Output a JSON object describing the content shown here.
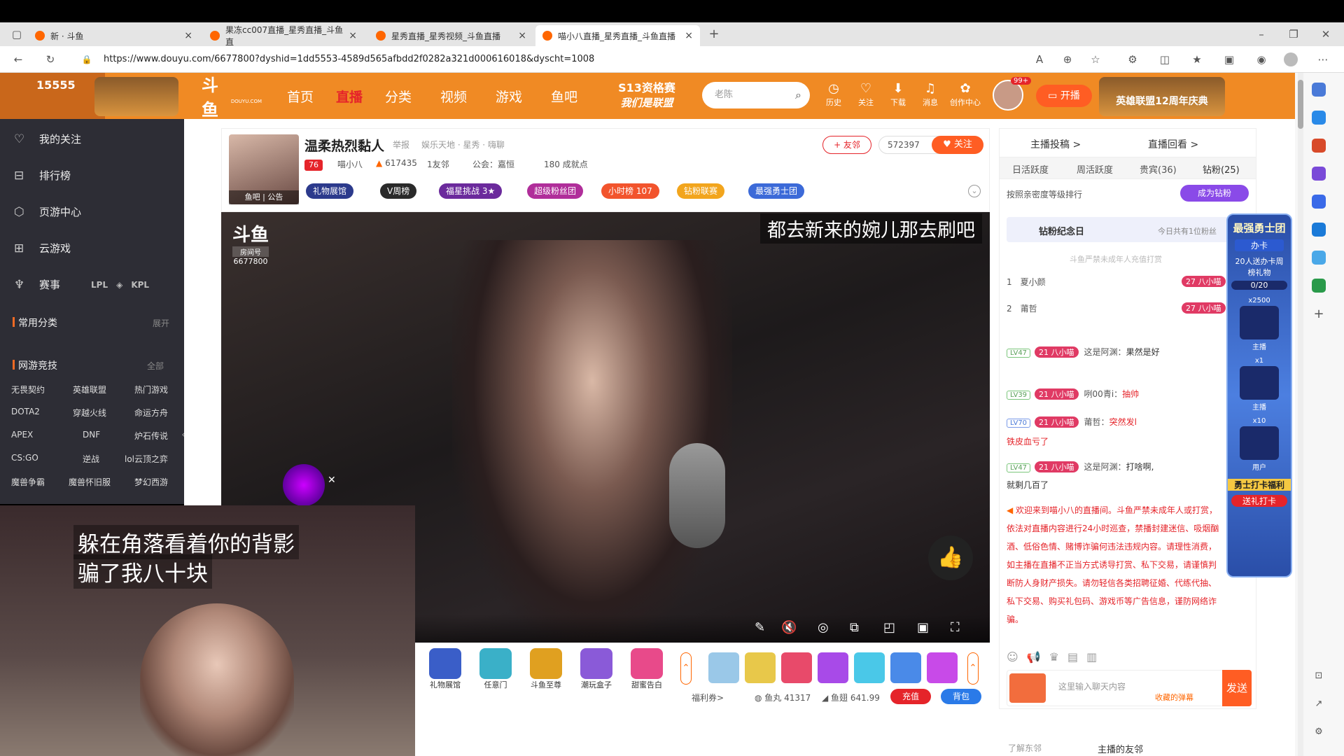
{
  "browser": {
    "tabs": [
      {
        "title": "新 · 斗鱼",
        "active": false
      },
      {
        "title": "果冻cc007直播_星秀直播_斗鱼直",
        "active": false
      },
      {
        "title": "星秀直播_星秀视频_斗鱼直播",
        "active": false
      },
      {
        "title": "喵小八直播_星秀直播_斗鱼直播",
        "active": true
      }
    ],
    "url": "https://www.douyu.com/6677800?dyshid=1dd5553-4589d565afbdd2f0282a321d000616018&dyscht=1008"
  },
  "header": {
    "corner_number": "15555",
    "logo": "斗鱼",
    "logo_sub": "DOUYU.COM",
    "nav": [
      "首页",
      "直播",
      "分类",
      "视频",
      "游戏",
      "鱼吧"
    ],
    "banner_top": "S13资格赛",
    "banner_bottom": "我们是联盟",
    "search_placeholder": "老陈",
    "icons": [
      {
        "label": "历史",
        "icon": "clock-icon"
      },
      {
        "label": "关注",
        "icon": "heart-icon"
      },
      {
        "label": "下载",
        "icon": "download-icon"
      },
      {
        "label": "消息",
        "icon": "bell-icon"
      },
      {
        "label": "创作中心",
        "icon": "bulb-icon"
      }
    ],
    "avatar_badge": "99+",
    "live_button": "开播",
    "right_banner": "英雄联盟12周年庆典"
  },
  "sidebar": {
    "items": [
      {
        "label": "我的关注",
        "icon": "heart-outline-icon"
      },
      {
        "label": "排行榜",
        "icon": "ranking-icon"
      },
      {
        "label": "页游中心",
        "icon": "shield-icon"
      },
      {
        "label": "云游戏",
        "icon": "gamepad-icon"
      },
      {
        "label": "赛事",
        "icon": "trophy-icon"
      }
    ],
    "common_label": "常用分类",
    "expand": "展开",
    "netgame_label": "网游竞技",
    "all_label": "全部",
    "games": [
      "无畏契约",
      "英雄联盟",
      "热门游戏",
      "DOTA2",
      "穿越火线",
      "命运方舟",
      "APEX",
      "DNF",
      "炉石传说",
      "CS:GO",
      "逆战",
      "lol云顶之弈",
      "魔兽争霸",
      "魔兽怀旧服",
      "梦幻西游"
    ]
  },
  "streamer": {
    "title": "温柔热烈黏人",
    "report": "举报",
    "breadcrumb": "娱乐天地 · 星秀 · 嗨聊",
    "level": "76",
    "name": "喵小八",
    "heat": "617435",
    "friends": "1友邻",
    "guild": "公会：嘉恒",
    "achievements": "180 成就点",
    "avatar_tags": "鱼吧 | 公告",
    "friend_btn": "+ 友邻",
    "follow_count": "572397",
    "follow_btn": "关注",
    "badges": [
      "礼物展馆",
      "V周榜",
      "福星挑战 3★",
      "超级粉丝团",
      "小时榜 107",
      "钻粉联赛",
      "最强勇士团"
    ]
  },
  "video": {
    "room_logo": "斗鱼",
    "room_label": "房间号",
    "room_id": "6677800",
    "subtitle": "都去新来的婉儿那去刷吧"
  },
  "gift_bar": {
    "gifts": [
      "礼物展馆",
      "任意门",
      "斗鱼至尊",
      "潮玩盒子",
      "甜蜜告白"
    ],
    "welfare": "福利券>",
    "fishball_label": "鱼丸",
    "fishball": "41317",
    "fin_label": "鱼翅",
    "fin": "641.99",
    "recharge": "充值",
    "backpack": "背包"
  },
  "chat": {
    "tabs_top": [
      "主播投稿 >",
      "直播回看 >"
    ],
    "tabs": [
      "日活跃度",
      "周活跃度",
      "贵宾(36)",
      "钻粉(25)"
    ],
    "sort_label": "按照亲密度等级排行",
    "become_diamond": "成为钻粉",
    "diamond_day": "钻粉纪念日",
    "today_note": "今日共有1位粉丝",
    "minor_notice": "斗鱼严禁未成年人充值打赏",
    "rank": [
      {
        "rank": "1",
        "name": "夏小颜",
        "fan": "27 八小喵"
      },
      {
        "rank": "2",
        "name": "莆哲",
        "fan": "27 八小喵"
      }
    ],
    "messages": [
      {
        "lv": "LV47",
        "fan": "21 八小喵",
        "user": "这是阿渊：",
        "text": "果然是好"
      },
      {
        "lv": "LV39",
        "fan": "21 八小喵",
        "user": "咧00青i：",
        "text": "抽帅"
      },
      {
        "lv": "LV70",
        "fan": "21 八小喵",
        "user": "莆哲：",
        "text": "突然发l"
      },
      {
        "lv": "",
        "fan": "",
        "user": "",
        "text": "铁皮血亏了"
      },
      {
        "lv": "LV47",
        "fan": "21 八小喵",
        "user": "这是阿渊：",
        "text": "打啥啊,"
      },
      {
        "lv": "",
        "fan": "",
        "user": "",
        "text": "就剩几百了"
      }
    ],
    "system_notice": "欢迎来到喵小八的直播间。斗鱼严禁未成年人或打赏，依法对直播内容进行24小时巡查，禁播封建迷信、吸烟酗酒、低俗色情、赌博诈骗何违法违规内容。请理性消费，如主播在直播不正当方式诱导打赏、私下交易，请谨慎判断防人身财产损失。请勿轻信各类招聘征婚、代练代抽、私下交易、购买礼包码、游戏币等广告信息，谨防网络诈骗。",
    "input_placeholder": "这里输入聊天内容",
    "collect_btn": "收藏的弹幕",
    "send": "发送",
    "bottom_left": "了解东邻",
    "bottom_right": "主播的友邻"
  },
  "promo": {
    "title": "最强勇士团",
    "card": "办卡",
    "desc": "20人送办卡周榜礼物",
    "progress": "0/20",
    "m1": "x2500",
    "m1_label": "主播",
    "m2": "x1",
    "m2_label": "主播",
    "m3": "x10",
    "m3_label": "用户",
    "welfare": "勇士打卡福利",
    "send": "送礼打卡"
  },
  "overlay": {
    "line1": "躲在角落看着你的背影",
    "line2": "骗了我八十块"
  },
  "colors": {
    "header": "#f08a24",
    "sidebar": "#2d2d35",
    "accent": "#ff5d23"
  }
}
